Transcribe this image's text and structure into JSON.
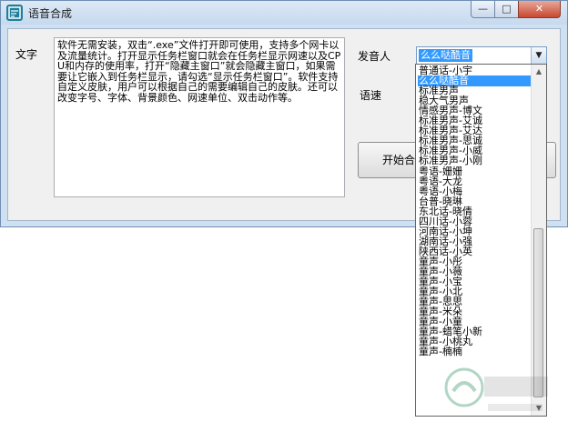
{
  "window": {
    "title": "语音合成",
    "minimize_glyph": "—",
    "maximize_glyph": "□",
    "close_glyph": "✕"
  },
  "form": {
    "text_label": "文字",
    "speaker_label": "发音人",
    "speed_label": "语速",
    "text_content": "软件无需安装，双击“.exe”文件打开即可使用，支持多个网卡以及流量统计。打开显示任务栏窗口就会在任务栏显示网速以及CPU和内存的使用率，打开“隐藏主窗口”就会隐藏主窗口，如果需要让它嵌入到任务栏显示，请勾选“显示任务栏窗口”。软件支持自定义皮肤，用户可以根据自己的需要编辑自己的皮肤。还可以改变字号、字体、背景颜色、网速单位、双击动作等。",
    "speaker_selected": "么么哒酷音",
    "start_button": "开始合"
  },
  "dropdown": {
    "items": [
      "普通话-小宇",
      "么么哒酷音",
      "标准男声",
      "稳大气男声",
      "情感男声-博文",
      "标准男声-艾诚",
      "标准男声-艾达",
      "标准男声-思诚",
      "标准男声-小威",
      "标准男声-小刚",
      "粤语-姗姗",
      "粤语-大龙",
      "粤语-小梅",
      "台普-晓琳",
      "东北话-晓倩",
      "四川话-小蓉",
      "河南话-小坤",
      "湖南话-小强",
      "陕西话-小英",
      "童声-小彤",
      "童声-小薇",
      "童声-小宝",
      "童声-小北",
      "童声-思思",
      "童声-米朵",
      "童声-小童",
      "童声-蜡笔小新",
      "童声-小桃丸",
      "童声-楠楠"
    ],
    "selected_index": 1,
    "scroll_up_glyph": "▲",
    "scroll_down_glyph": "▼"
  },
  "icons": {
    "app": "app-icon",
    "combo_arrow": "chevron-down-icon"
  },
  "colors": {
    "selection": "#3399ff",
    "title_bar": "#c6d9ee",
    "close_button": "#c7472f"
  }
}
